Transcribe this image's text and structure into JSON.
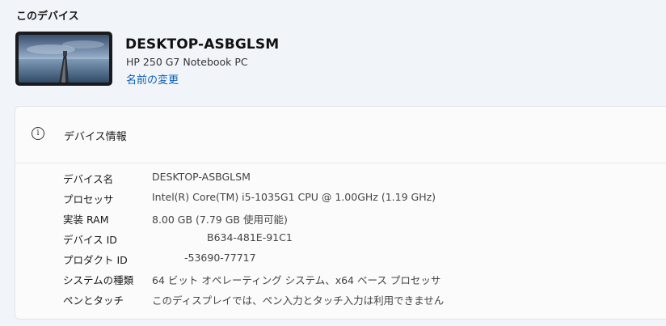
{
  "section_title": "このデバイス",
  "device": {
    "name": "DESKTOP-ASBGLSM",
    "model": "HP 250 G7 Notebook PC",
    "rename_label": "名前の変更"
  },
  "device_info": {
    "title": "デバイス情報",
    "rows": [
      {
        "label": "デバイス名",
        "value": "DESKTOP-ASBGLSM"
      },
      {
        "label": "プロセッサ",
        "value": "Intel(R) Core(TM) i5-1035G1 CPU @ 1.00GHz   (1.19 GHz)"
      },
      {
        "label": "実装 RAM",
        "value": "8.00 GB (7.79 GB 使用可能)"
      },
      {
        "label": "デバイス ID",
        "value": "B634-481E-91C1"
      },
      {
        "label": "プロダクト ID",
        "value": "-53690-77717"
      },
      {
        "label": "システムの種類",
        "value": "64 ビット オペレーティング システム、x64 ベース プロセッサ"
      },
      {
        "label": "ペンとタッチ",
        "value": "このディスプレイでは、ペン入力とタッチ入力は利用できません"
      }
    ]
  },
  "icons": {
    "info": "info-icon",
    "thumbnail": "desktop-wallpaper-thumbnail"
  },
  "colors": {
    "background": "#f1f4f9",
    "card": "#fbfbfc",
    "link": "#0a5fb4"
  }
}
